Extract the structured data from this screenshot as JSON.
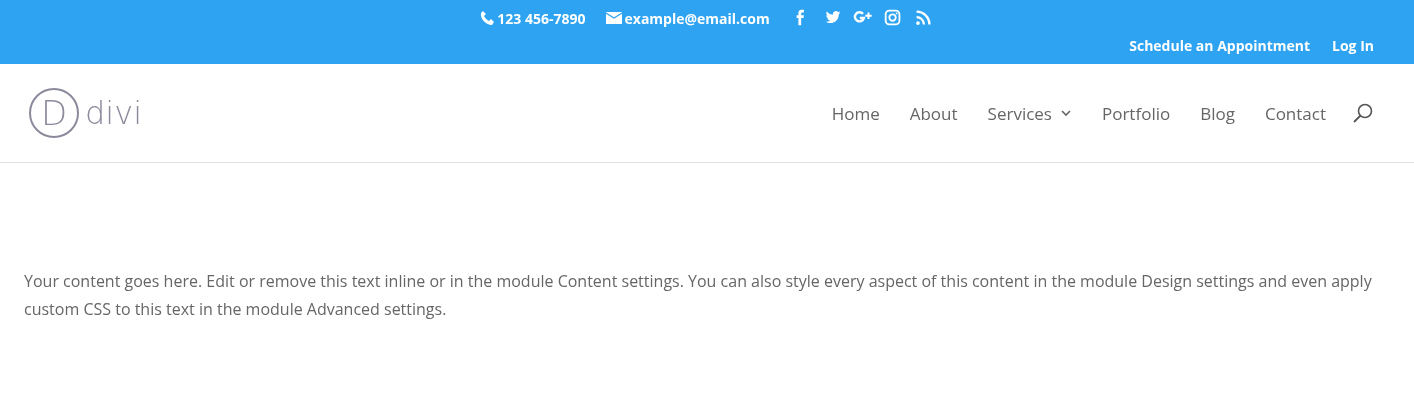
{
  "top_bar": {
    "phone": "123 456-7890",
    "email": "example@email.com",
    "social": [
      {
        "kind": "facebook"
      },
      {
        "kind": "twitter"
      },
      {
        "kind": "google-plus"
      },
      {
        "kind": "instagram"
      },
      {
        "kind": "rss"
      }
    ],
    "links": [
      "Schedule an Appointment",
      "Log In"
    ]
  },
  "header": {
    "logo": {
      "mark": "D",
      "name": "divi"
    },
    "nav": [
      {
        "label": "Home",
        "has_submenu": false
      },
      {
        "label": "About",
        "has_submenu": false
      },
      {
        "label": "Services",
        "has_submenu": true
      },
      {
        "label": "Portfolio",
        "has_submenu": false
      },
      {
        "label": "Blog",
        "has_submenu": false
      },
      {
        "label": "Contact",
        "has_submenu": false
      }
    ]
  },
  "content": {
    "text": "Your content goes here. Edit or remove this text inline or in the module Content settings. You can also style every aspect of this content in the module Design settings and even apply custom CSS to this text in the module Advanced settings."
  }
}
